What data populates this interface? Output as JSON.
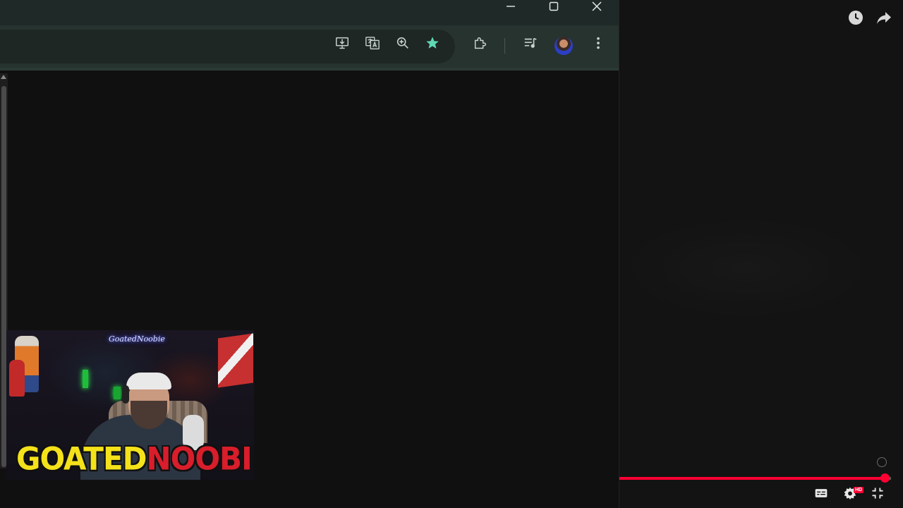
{
  "browser": {
    "window_controls": {
      "minimize_icon": "minimize-icon",
      "maximize_icon": "maximize-icon",
      "close_icon": "close-icon"
    },
    "toolbar": {
      "icons": [
        "install-app-icon",
        "translate-icon",
        "zoom-icon",
        "bookmark-star-icon",
        "extensions-icon",
        "media-controls-icon",
        "profile-avatar",
        "menu-icon"
      ],
      "bookmark_star_color": "#5fd8b4"
    }
  },
  "webcam": {
    "neon_sign": "GoatedNoobie",
    "logo_part1": "GOATED",
    "logo_part2": "NOOBIE",
    "logo_colors": {
      "part1": "#f4e21a",
      "part2": "#d91d2b"
    }
  },
  "video": {
    "top_icons": [
      "watch-later-icon",
      "share-icon"
    ],
    "progress": 0.98,
    "progress_color": "#ff0033",
    "controls": [
      "subtitles-icon",
      "settings-icon",
      "exit-fullscreen-icon"
    ],
    "quality_badge": "HD"
  }
}
